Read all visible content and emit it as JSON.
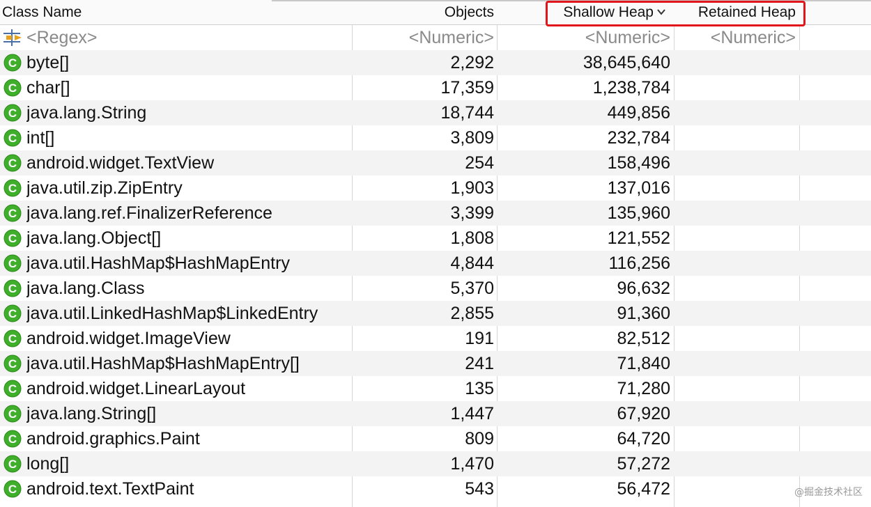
{
  "header": {
    "class_name": "Class Name",
    "objects": "Objects",
    "shallow_heap": "Shallow Heap",
    "retained_heap": "Retained Heap"
  },
  "filter": {
    "name": "<Regex>",
    "objects": "<Numeric>",
    "shallow": "<Numeric>",
    "retained": "<Numeric>"
  },
  "rows": [
    {
      "name": "byte[]",
      "objects": "2,292",
      "shallow": "38,645,640"
    },
    {
      "name": "char[]",
      "objects": "17,359",
      "shallow": "1,238,784"
    },
    {
      "name": "java.lang.String",
      "objects": "18,744",
      "shallow": "449,856"
    },
    {
      "name": "int[]",
      "objects": "3,809",
      "shallow": "232,784"
    },
    {
      "name": "android.widget.TextView",
      "objects": "254",
      "shallow": "158,496"
    },
    {
      "name": "java.util.zip.ZipEntry",
      "objects": "1,903",
      "shallow": "137,016"
    },
    {
      "name": "java.lang.ref.FinalizerReference",
      "objects": "3,399",
      "shallow": "135,960"
    },
    {
      "name": "java.lang.Object[]",
      "objects": "1,808",
      "shallow": "121,552"
    },
    {
      "name": "java.util.HashMap$HashMapEntry",
      "objects": "4,844",
      "shallow": "116,256"
    },
    {
      "name": "java.lang.Class",
      "objects": "5,370",
      "shallow": "96,632"
    },
    {
      "name": "java.util.LinkedHashMap$LinkedEntry",
      "objects": "2,855",
      "shallow": "91,360"
    },
    {
      "name": "android.widget.ImageView",
      "objects": "191",
      "shallow": "82,512"
    },
    {
      "name": "java.util.HashMap$HashMapEntry[]",
      "objects": "241",
      "shallow": "71,840"
    },
    {
      "name": "android.widget.LinearLayout",
      "objects": "135",
      "shallow": "71,280"
    },
    {
      "name": "java.lang.String[]",
      "objects": "1,447",
      "shallow": "67,920"
    },
    {
      "name": "android.graphics.Paint",
      "objects": "809",
      "shallow": "64,720"
    },
    {
      "name": "long[]",
      "objects": "1,470",
      "shallow": "57,272"
    },
    {
      "name": "android.text.TextPaint",
      "objects": "543",
      "shallow": "56,472"
    }
  ],
  "watermark": "@掘金技术社区",
  "colors": {
    "class_icon": "#3fae2a",
    "highlight_box": "#e0161c",
    "alt_row": "#f3f3f3"
  },
  "icons": {
    "class_icon": "class-c-icon",
    "filter_icon": "regex-filter-icon",
    "sort": "chevron-down-icon"
  }
}
